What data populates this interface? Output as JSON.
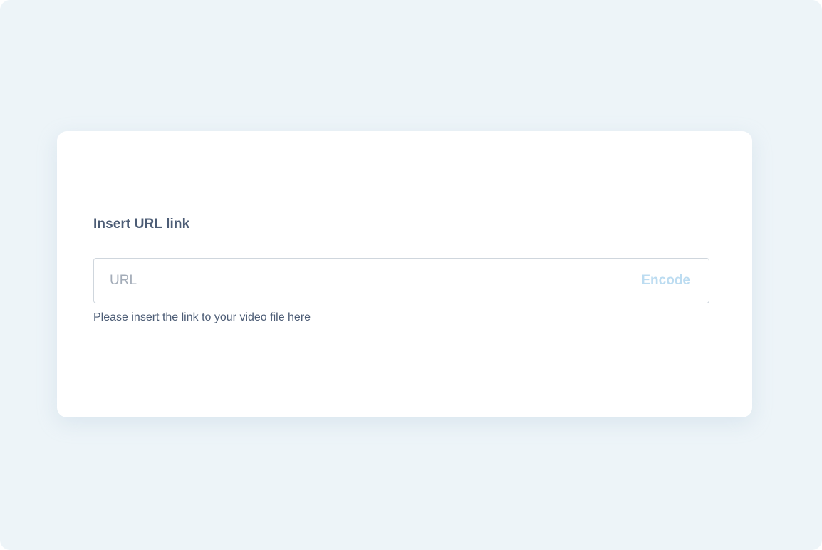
{
  "form": {
    "label": "Insert URL link",
    "url_input": {
      "value": "",
      "placeholder": "URL"
    },
    "encode_label": "Encode",
    "helper_text": "Please insert the link to your video file here"
  },
  "colors": {
    "background": "#edf4f8",
    "card": "#ffffff",
    "text": "#4c5c75",
    "placeholder": "#a3acb8",
    "encode_button": "#bcdcf1",
    "input_border": "#cfd6dd"
  }
}
